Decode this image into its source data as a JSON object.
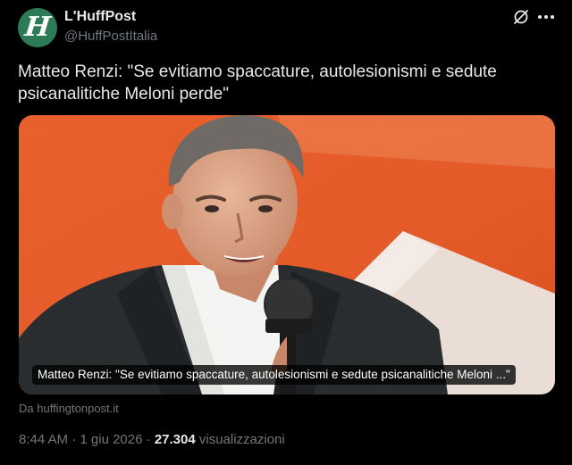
{
  "author": {
    "avatar_letter": "H",
    "display_name": "L'HuffPost",
    "handle": "@HuffPostItalia",
    "avatar_color": "#2c7a56"
  },
  "icons": {
    "grok": "grok-icon",
    "more": "more-icon"
  },
  "tweet": {
    "text": "Matteo Renzi: \"Se evitiamo spaccature, autolesionismi e sedute psicanalitiche Meloni perde\""
  },
  "card": {
    "caption": "Matteo Renzi: \"Se evitiamo spaccature, autolesionismi e sedute psicanalitiche Meloni ...\"",
    "source": "Da huffingtonpost.it",
    "background_color": "#e0582a"
  },
  "meta": {
    "time": "8:44 AM",
    "separator": "·",
    "date": "1 giu 2026",
    "views_count": "27.304",
    "views_label": "visualizzazioni"
  },
  "colors": {
    "background": "#000000",
    "text_primary": "#e7e9ea",
    "text_secondary": "#71767b"
  }
}
